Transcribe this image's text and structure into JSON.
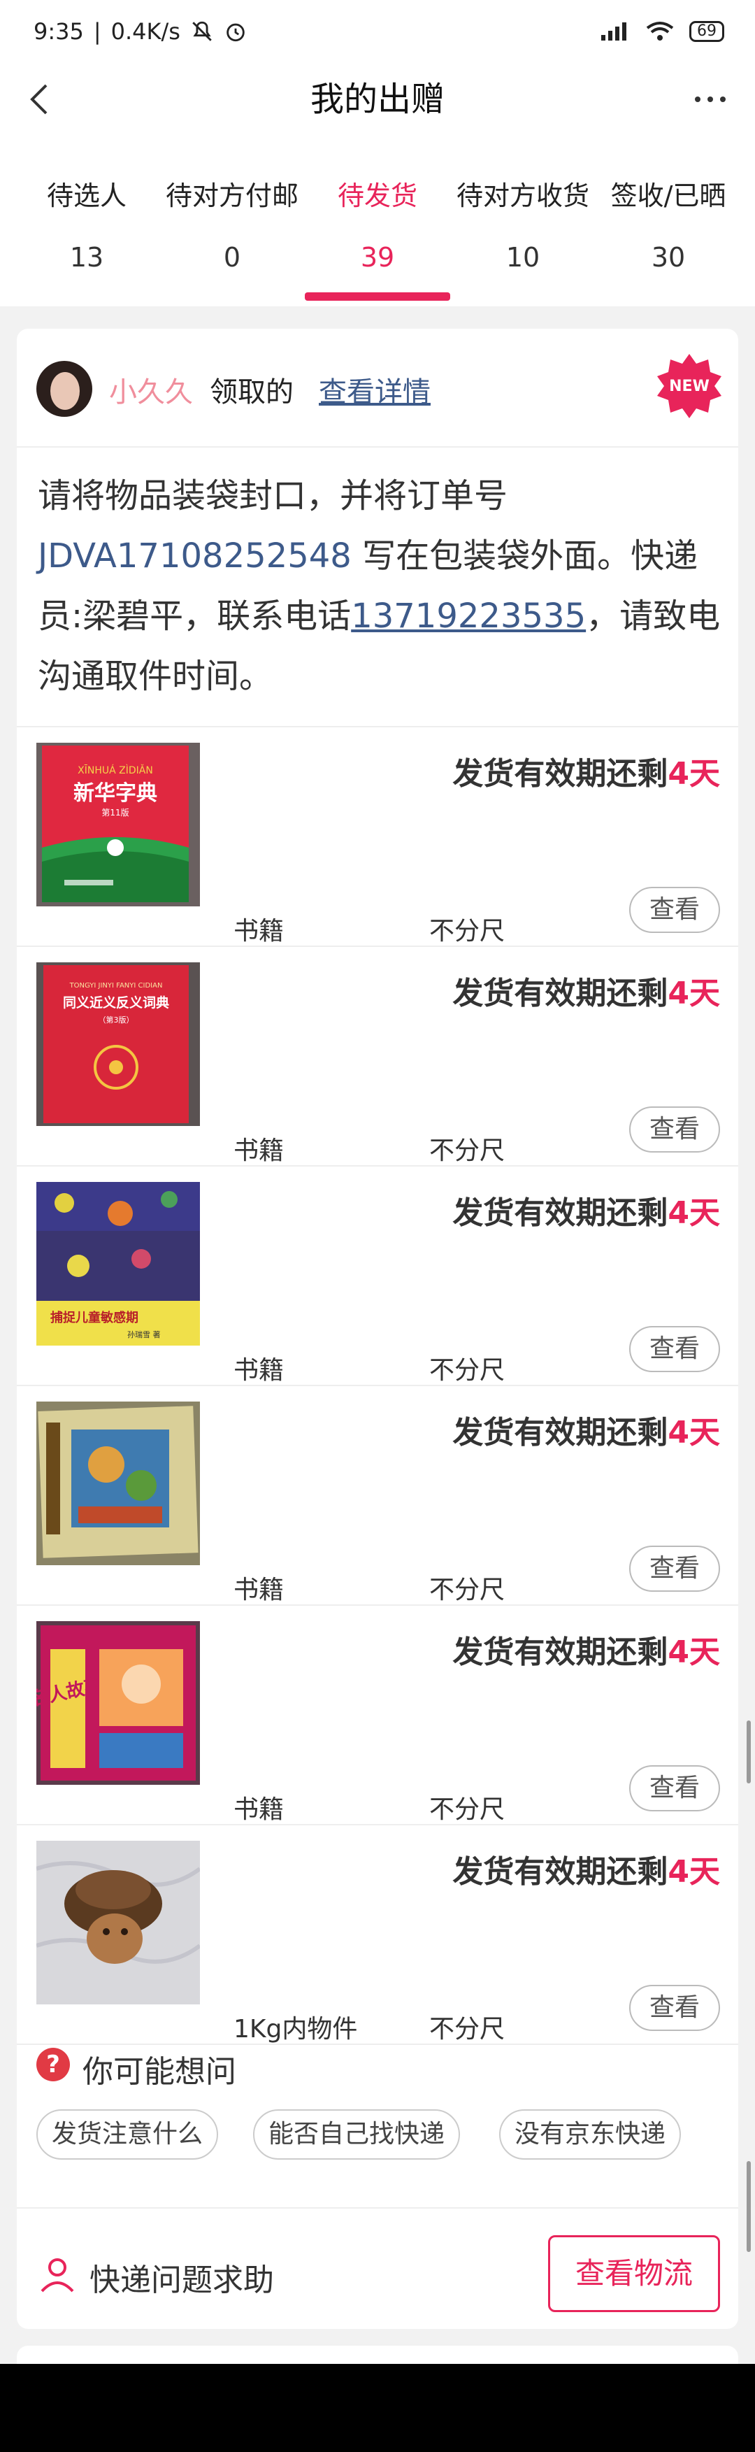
{
  "status_bar": {
    "time": "9:35",
    "speed": "0.4K/s",
    "battery": "69"
  },
  "nav": {
    "title": "我的出赠"
  },
  "tabs": [
    {
      "label": "待选人",
      "count": "13"
    },
    {
      "label": "待对方付邮",
      "count": "0"
    },
    {
      "label": "待发货",
      "count": "39"
    },
    {
      "label": "待对方收货",
      "count": "10"
    },
    {
      "label": "签收/已晒",
      "count": "30"
    }
  ],
  "card": {
    "username": "小久久",
    "claim_text": "领取的",
    "detail_link": "查看详情",
    "badge": "NEW",
    "notice": {
      "part1": "请将物品装袋封口，并将订单号 ",
      "order": "JDVA17108252548",
      "part2": " 写在包装袋外面。快递员:梁碧平，联系电话",
      "phone": "13719223535",
      "part3": "，请致电沟通取件时间。"
    },
    "items": [
      {
        "deadline": "发货有效期还剩",
        "days": "4天",
        "category": "书籍",
        "size": "不分尺",
        "button": "查看"
      },
      {
        "deadline": "发货有效期还剩",
        "days": "4天",
        "category": "书籍",
        "size": "不分尺",
        "button": "查看"
      },
      {
        "deadline": "发货有效期还剩",
        "days": "4天",
        "category": "书籍",
        "size": "不分尺",
        "button": "查看"
      },
      {
        "deadline": "发货有效期还剩",
        "days": "4天",
        "category": "书籍",
        "size": "不分尺",
        "button": "查看"
      },
      {
        "deadline": "发货有效期还剩",
        "days": "4天",
        "category": "书籍",
        "size": "不分尺",
        "button": "查看"
      },
      {
        "deadline": "发货有效期还剩",
        "days": "4天",
        "category": "1Kg内物件",
        "size": "不分尺",
        "button": "查看"
      }
    ],
    "book_covers": {
      "xinhua_pinyin": "XĪNHUÁ ZÌDIǍN",
      "xinhua_title": "新华字典",
      "xinhua_edition": "第11版",
      "tongyi_pinyin": "TONGYI JINYI FANYI CIDIAN",
      "tongyi_title": "同义近义反义词典",
      "tongyi_edition": "（第3版）",
      "kids_title": "捕捉儿童敏感期",
      "kids_author": "孙瑞雪 著",
      "famous_title": "名人故事"
    },
    "faq": {
      "icon": "?",
      "title": "你可能想问",
      "chips": [
        "发货注意什么",
        "能否自己找快递",
        "没有京东快递"
      ]
    },
    "help": {
      "text": "快递问题求助",
      "button": "查看物流"
    }
  }
}
